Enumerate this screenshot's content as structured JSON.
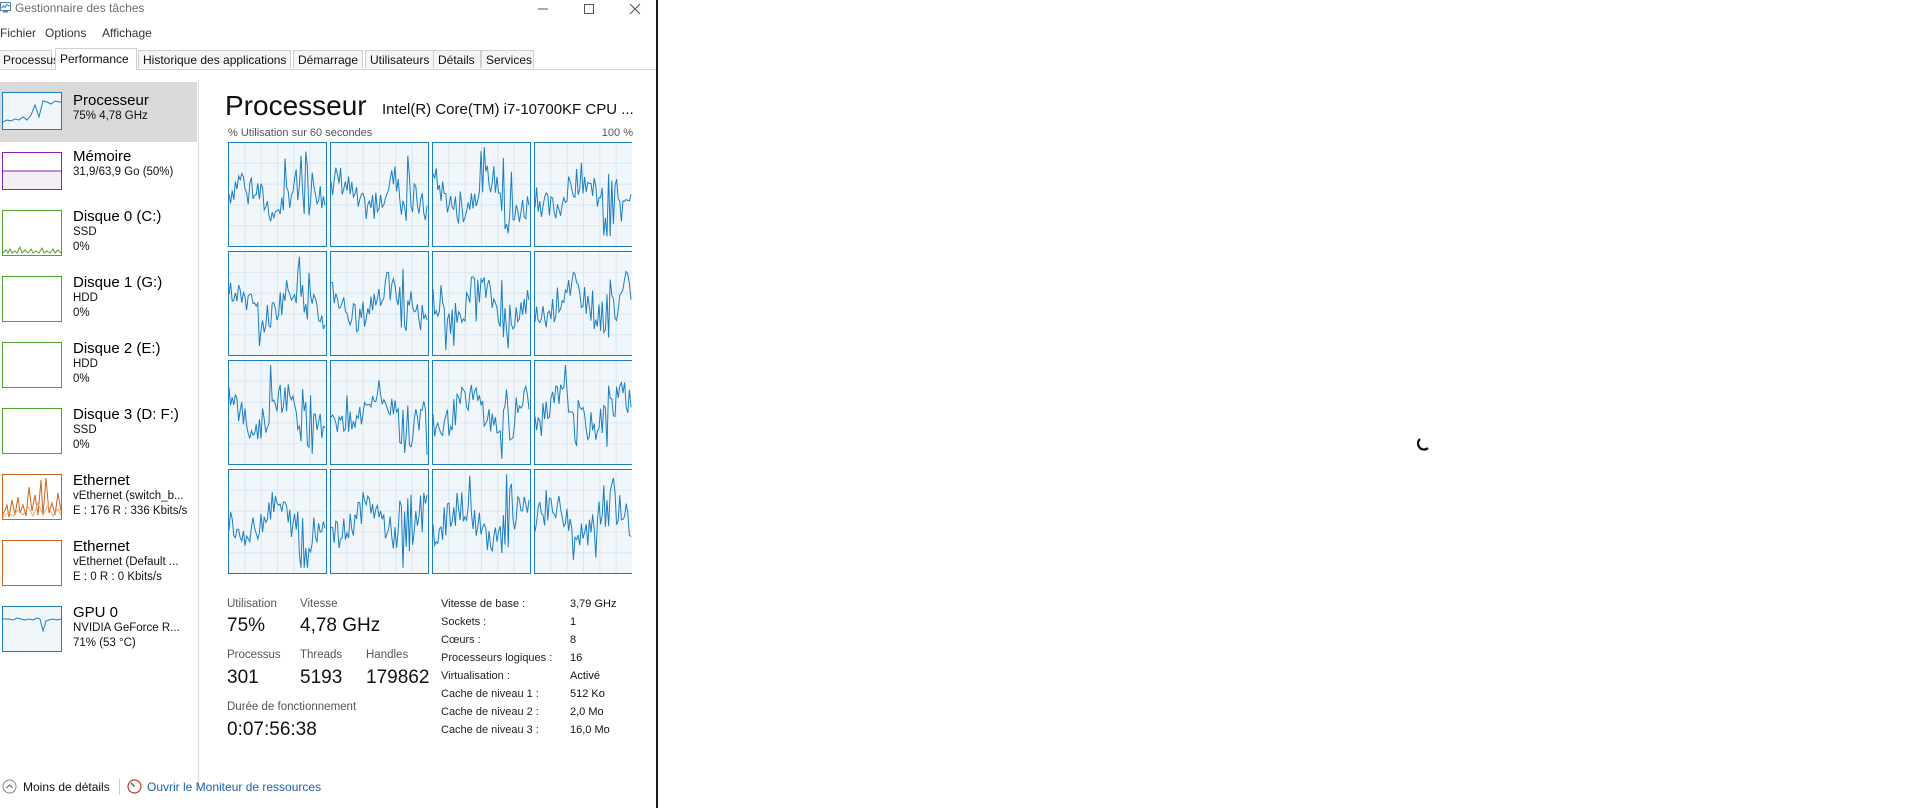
{
  "window": {
    "title": "Gestionnaire des tâches"
  },
  "menu": [
    "Fichier",
    "Options",
    "Affichage"
  ],
  "tabs": [
    "Processus",
    "Performance",
    "Historique des applications",
    "Démarrage",
    "Utilisateurs",
    "Détails",
    "Services"
  ],
  "sidebar": [
    {
      "name": "Processeur",
      "sub1": "75%  4,78 GHz",
      "sub2": "",
      "color": "#1a7fc1",
      "fill": "#f1f6fa"
    },
    {
      "name": "Mémoire",
      "sub1": "31,9/63,9 Go (50%)",
      "sub2": "",
      "color": "#8b22b5",
      "fill": "#f4eef7"
    },
    {
      "name": "Disque 0 (C:)",
      "sub1": "SSD",
      "sub2": "0%",
      "color": "#4ea72a",
      "fill": "#ffffff"
    },
    {
      "name": "Disque 1 (G:)",
      "sub1": "HDD",
      "sub2": "0%",
      "color": "#4ea72a",
      "fill": "#ffffff"
    },
    {
      "name": "Disque 2 (E:)",
      "sub1": "HDD",
      "sub2": "0%",
      "color": "#4ea72a",
      "fill": "#ffffff"
    },
    {
      "name": "Disque 3 (D: F:)",
      "sub1": "SSD",
      "sub2": "0%",
      "color": "#4ea72a",
      "fill": "#ffffff"
    },
    {
      "name": "Ethernet",
      "sub1": "vEthernet (switch_b...",
      "sub2": "E : 176  R : 336 Kbits/s",
      "color": "#c8651b",
      "fill": "#ffffff"
    },
    {
      "name": "Ethernet",
      "sub1": "vEthernet (Default ...",
      "sub2": "E : 0  R : 0 Kbits/s",
      "color": "#c8651b",
      "fill": "#ffffff"
    },
    {
      "name": "GPU 0",
      "sub1": "NVIDIA GeForce R...",
      "sub2": "71%  (53 °C)",
      "color": "#1a7fc1",
      "fill": "#f1f6fa"
    }
  ],
  "main": {
    "title": "Processeur",
    "cpu_name": "Intel(R) Core(TM) i7-10700KF CPU ...",
    "util_label": "% Utilisation sur 60 secondes",
    "util_max": "100 %",
    "graph_color": "#1a7fc1",
    "graph_fill": "#f1f6fa",
    "stats": {
      "utilisation_label": "Utilisation",
      "utilisation": "75%",
      "vitesse_label": "Vitesse",
      "vitesse": "4,78 GHz",
      "processus_label": "Processus",
      "processus": "301",
      "threads_label": "Threads",
      "threads": "5193",
      "handles_label": "Handles",
      "handles": "179862",
      "uptime_label": "Durée de fonctionnement",
      "uptime": "0:07:56:38"
    },
    "specs": [
      {
        "k": "Vitesse de base :",
        "v": "3,79 GHz"
      },
      {
        "k": "Sockets :",
        "v": "1"
      },
      {
        "k": "Cœurs :",
        "v": "8"
      },
      {
        "k": "Processeurs logiques :",
        "v": "16"
      },
      {
        "k": "Virtualisation :",
        "v": "Activé"
      },
      {
        "k": "Cache de niveau 1 :",
        "v": "512 Ko"
      },
      {
        "k": "Cache de niveau 2 :",
        "v": "2,0 Mo"
      },
      {
        "k": "Cache de niveau 3 :",
        "v": "16,0 Mo"
      }
    ]
  },
  "footer": {
    "less_details": "Moins de détails",
    "resource_monitor": "Ouvrir le Moniteur de ressources"
  }
}
